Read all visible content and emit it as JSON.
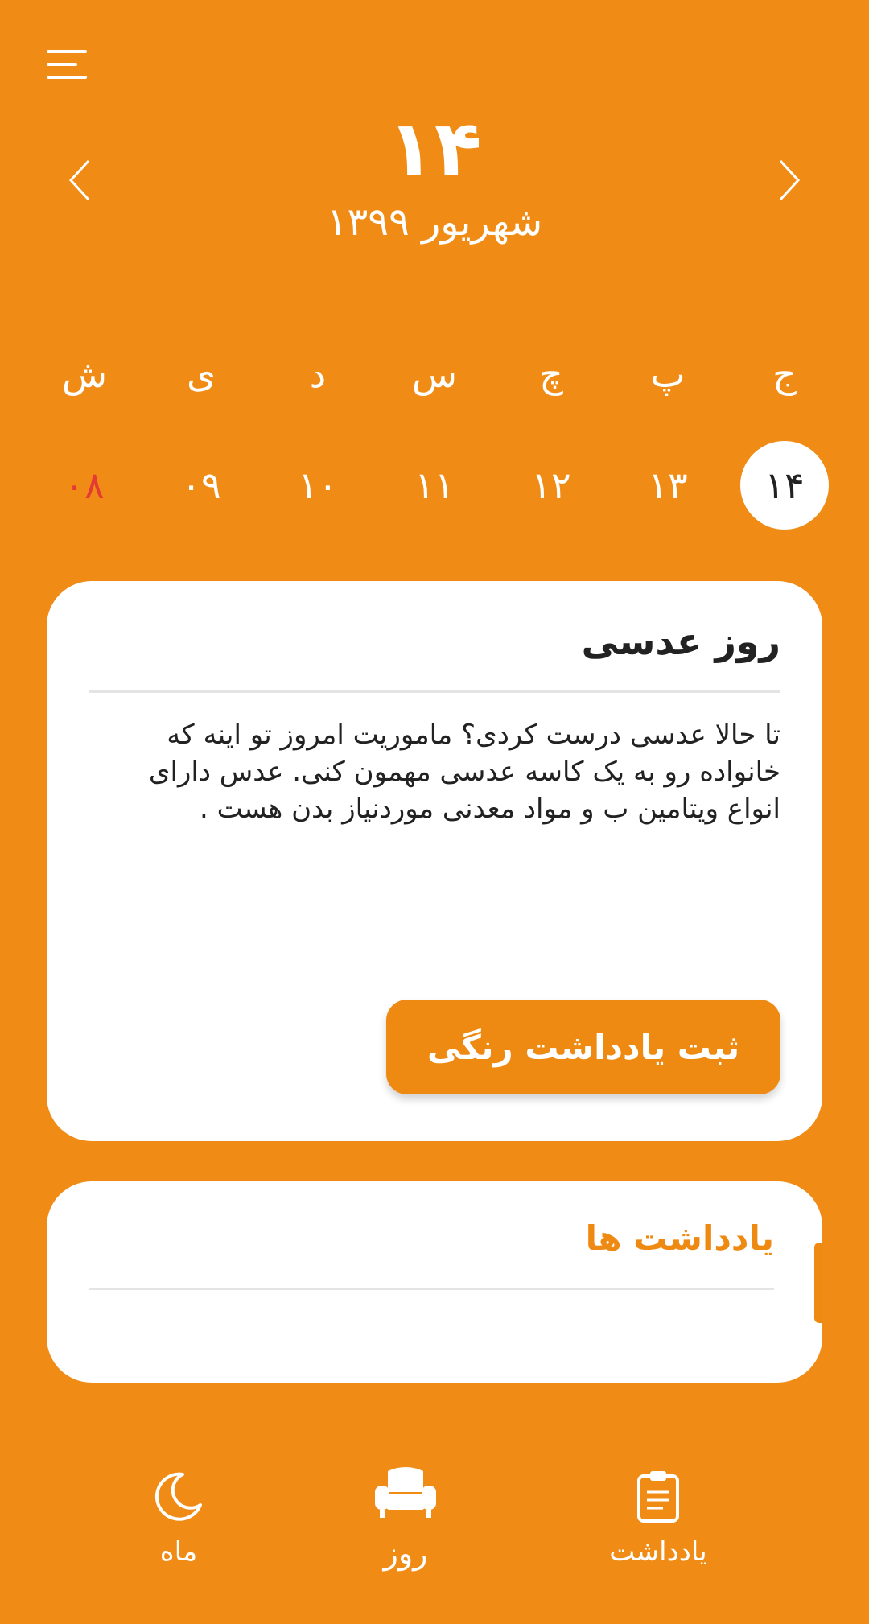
{
  "header": {
    "day_big": "۱۴",
    "month_year": "شهریور ۱۳۹۹"
  },
  "week": {
    "weekdays": [
      "ج",
      "پ",
      "چ",
      "س",
      "د",
      "ی",
      "ش"
    ],
    "dates": [
      "۱۴",
      "۱۳",
      "۱۲",
      "۱۱",
      "۱۰",
      "۰۹",
      "۰۸"
    ],
    "selected_index": 0,
    "holiday_index": 6
  },
  "occasion_card": {
    "title": "روز عدسی",
    "body": "تا حالا عدسی درست کردی؟ ماموریت امروز تو اینه که خانواده رو به یک کاسه عدسی مهمون کنی. عدس دارای انواع ویتامین ب و مواد معدنی موردنیاز بدن هست .",
    "button_label": "ثبت یادداشت رنگی"
  },
  "notes_card": {
    "title": "یادداشت ها"
  },
  "bottom_nav": {
    "month_label": "ماه",
    "day_label": "روز",
    "notes_label": "یادداشت"
  },
  "colors": {
    "background": "#F08C16",
    "accent": "#EE8A12",
    "holiday": "#E53935",
    "card": "#FFFFFF"
  },
  "icons": {
    "menu": "hamburger-menu-icon",
    "prev": "chevron-left-icon",
    "next": "chevron-right-icon",
    "month": "crescent-moon-icon",
    "day": "armchair-icon",
    "notes": "clipboard-icon"
  }
}
